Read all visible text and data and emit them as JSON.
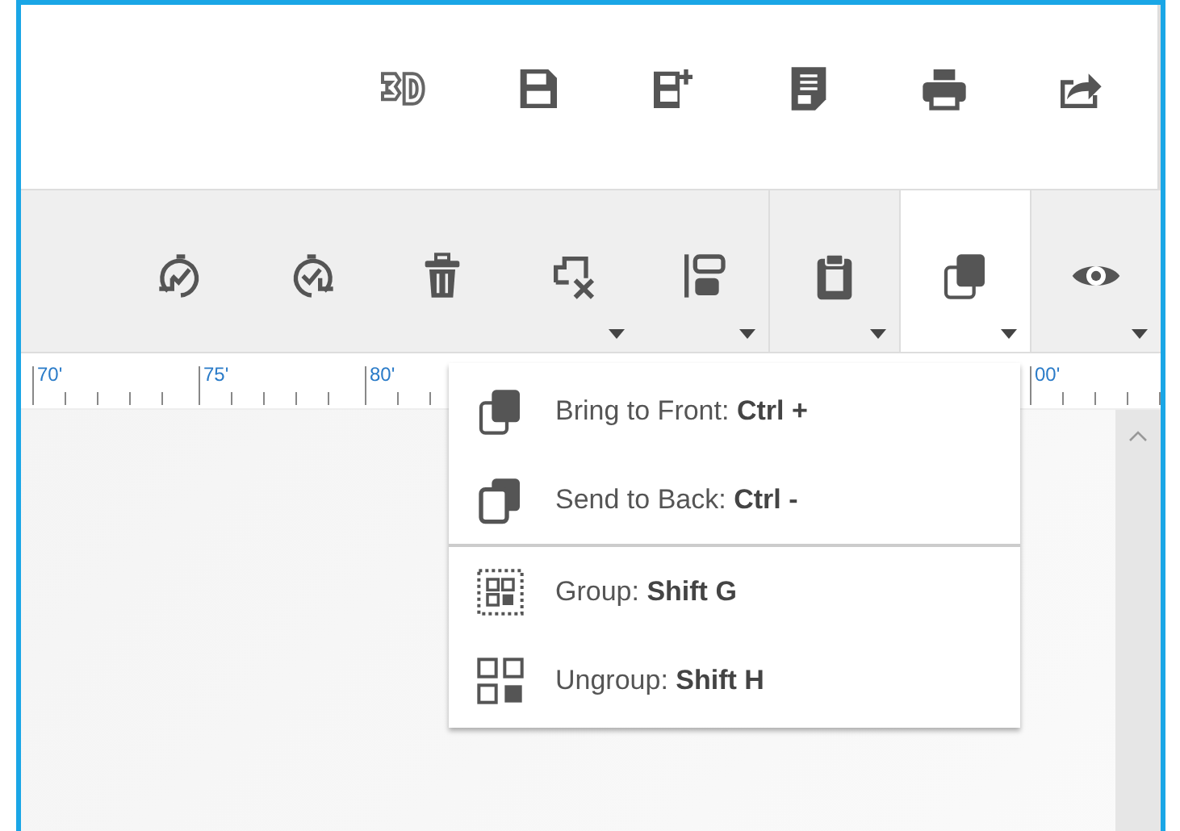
{
  "top_toolbar": [
    {
      "kind": "threed"
    },
    {
      "kind": "save"
    },
    {
      "kind": "save-new"
    },
    {
      "kind": "document"
    },
    {
      "kind": "print"
    },
    {
      "kind": "share"
    }
  ],
  "toolbar": [
    {
      "kind": "undo",
      "dropdown": false,
      "selected": false,
      "separator_before": false
    },
    {
      "kind": "redo",
      "dropdown": false,
      "selected": false,
      "separator_before": false
    },
    {
      "kind": "trash",
      "dropdown": false,
      "selected": false,
      "separator_before": false
    },
    {
      "kind": "clear",
      "dropdown": true,
      "selected": false,
      "separator_before": false
    },
    {
      "kind": "align",
      "dropdown": true,
      "selected": false,
      "separator_before": false
    },
    {
      "kind": "clipboard",
      "dropdown": true,
      "selected": false,
      "separator_before": true
    },
    {
      "kind": "arrange",
      "dropdown": true,
      "selected": true,
      "separator_before": true
    },
    {
      "kind": "eye",
      "dropdown": true,
      "selected": false,
      "separator_before": true
    }
  ],
  "ruler": {
    "labels": [
      "70'",
      "75'",
      "80'",
      "00'"
    ]
  },
  "menu": {
    "items": [
      {
        "kind": "front",
        "label": "Bring to Front: **Ctrl +**",
        "separator_before": false
      },
      {
        "kind": "back",
        "label": "Send to Back: **Ctrl -**",
        "separator_before": false
      },
      {
        "kind": "group",
        "label": "Group: **Shift G**",
        "separator_before": true
      },
      {
        "kind": "ungroup",
        "label": "Ungroup: **Shift H**",
        "separator_before": false
      }
    ]
  }
}
